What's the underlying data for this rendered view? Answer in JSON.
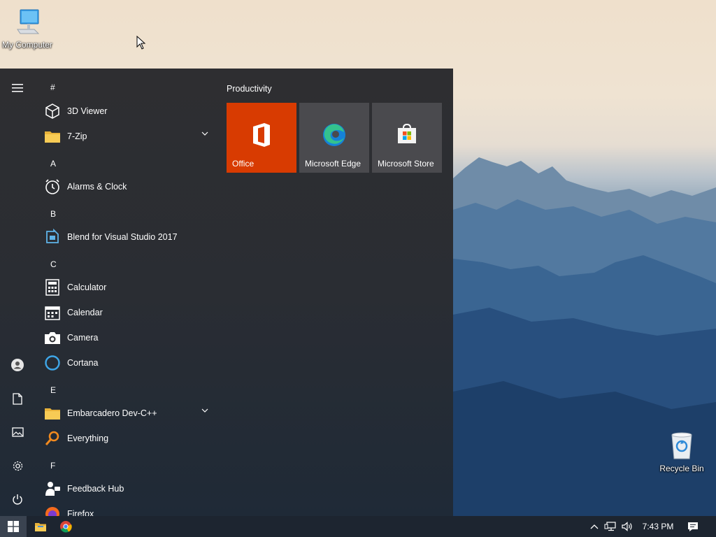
{
  "desktop": {
    "my_computer_label": "My Computer",
    "recycle_bin_label": "Recycle Bin"
  },
  "start_menu": {
    "rail": {
      "icons": [
        "hamburger-menu-icon",
        "user-account-icon",
        "documents-icon",
        "pictures-icon",
        "settings-icon",
        "power-icon"
      ]
    },
    "app_list": {
      "headers": [
        "#",
        "A",
        "B",
        "C",
        "E",
        "F"
      ],
      "apps": [
        {
          "name": "3D Viewer",
          "icon": "3d-viewer-icon",
          "expandable": false
        },
        {
          "name": "7-Zip",
          "icon": "folder-icon",
          "expandable": true
        },
        {
          "name": "Alarms & Clock",
          "icon": "alarm-clock-icon",
          "expandable": false
        },
        {
          "name": "Blend for Visual Studio 2017",
          "icon": "blend-icon",
          "expandable": false
        },
        {
          "name": "Calculator",
          "icon": "calculator-icon",
          "expandable": false
        },
        {
          "name": "Calendar",
          "icon": "calendar-icon",
          "expandable": false
        },
        {
          "name": "Camera",
          "icon": "camera-icon",
          "expandable": false
        },
        {
          "name": "Cortana",
          "icon": "cortana-icon",
          "expandable": false
        },
        {
          "name": "Embarcadero Dev-C++",
          "icon": "folder-icon",
          "expandable": true
        },
        {
          "name": "Everything",
          "icon": "magnifier-icon",
          "expandable": false
        },
        {
          "name": "Feedback Hub",
          "icon": "feedback-hub-icon",
          "expandable": false
        },
        {
          "name": "Firefox",
          "icon": "firefox-icon",
          "expandable": false
        }
      ]
    },
    "tiles": {
      "group_title": "Productivity",
      "items": [
        {
          "name": "Office",
          "icon": "office-icon",
          "color": "#d83b01"
        },
        {
          "name": "Microsoft Edge",
          "icon": "edge-icon",
          "color": "#4a4a4e"
        },
        {
          "name": "Microsoft Store",
          "icon": "store-icon",
          "color": "#4a4a4e"
        }
      ]
    }
  },
  "taskbar": {
    "clock": "7:43 PM",
    "icons": [
      "windows-start-icon",
      "file-explorer-icon",
      "chrome-icon",
      "chevron-up-icon",
      "network-icon",
      "volume-icon",
      "action-center-icon"
    ]
  },
  "colors": {
    "accent": "#d83b01",
    "taskbar": "#1d2530",
    "start_menu": "#2b2d31"
  }
}
